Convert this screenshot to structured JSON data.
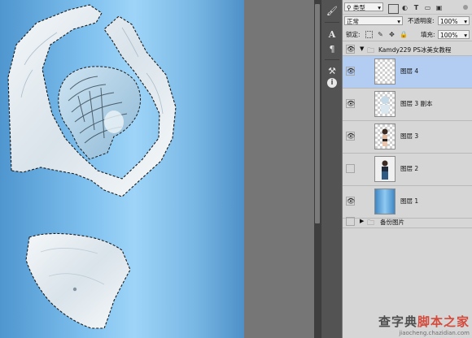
{
  "layers_panel": {
    "filter_kind": "类型",
    "blend_mode": "正常",
    "opacity_label": "不透明度:",
    "opacity_value": "100%",
    "lock_label": "锁定:",
    "fill_label": "填充:",
    "fill_value": "100%",
    "group_name": "Kamdy229  PS冰美女教程",
    "layers": [
      {
        "name": "图层 4",
        "visible": true,
        "selected": true,
        "thumbnail": "transparent"
      },
      {
        "name": "图层 3 副本",
        "visible": true,
        "selected": false,
        "thumbnail": "ice-figure"
      },
      {
        "name": "图层 3",
        "visible": true,
        "selected": false,
        "thumbnail": "woman-cutout"
      },
      {
        "name": "图层 2",
        "visible": false,
        "selected": false,
        "thumbnail": "woman-photo"
      },
      {
        "name": "图层 1",
        "visible": true,
        "selected": false,
        "thumbnail": "blue-gradient"
      }
    ],
    "backup_group_name": "备份图片"
  },
  "icon_strip": [
    "brush-presets-icon",
    "character-icon",
    "paragraph-icon",
    "tool-presets-icon",
    "info-icon"
  ],
  "watermark": {
    "text_grey": "查字典",
    "text_red": "脚本之家",
    "url": "jiaocheng.chazidian.com"
  },
  "colors": {
    "panel_bg": "#d6d6d6",
    "selected_layer": "#b3ccf2",
    "workspace_bg": "#767676"
  }
}
